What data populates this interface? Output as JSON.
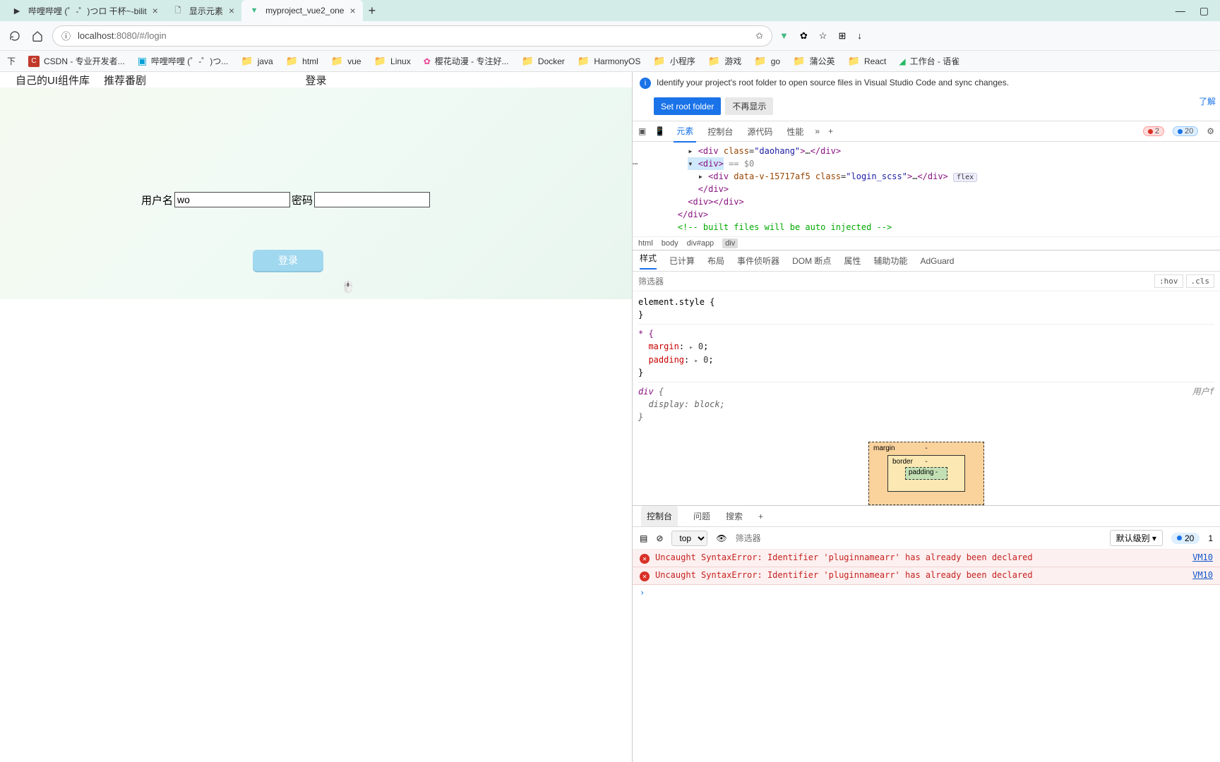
{
  "tabs": [
    {
      "title": "哔哩哔哩 (゜-゜)つロ 干杯~-bilit"
    },
    {
      "title": "显示元素"
    },
    {
      "title": "myproject_vue2_one",
      "active": true
    }
  ],
  "url": {
    "scheme": "localhost",
    "middle": ":8080/#/login"
  },
  "bookmarks": {
    "first": "下",
    "csdn": "CSDN - 专业开发者...",
    "bili": "哔哩哔哩 (゜-゜)つ...",
    "folders": [
      "java",
      "html",
      "vue",
      "Linux"
    ],
    "sakura": "樱花动漫 - 专注好...",
    "folders2": [
      "Docker",
      "HarmonyOS",
      "小程序",
      "游戏",
      "go",
      "蒲公英",
      "React"
    ],
    "workbench": "工作台 - 语雀"
  },
  "page": {
    "nav1": "自己的UI组件库",
    "nav2": "推荐番剧",
    "center_title": "登录",
    "username_label": "用户名",
    "username_value": "wo",
    "password_label": "密码",
    "login_btn": "登录"
  },
  "devtools": {
    "banner_msg": "Identify your project's root folder to open source files in Visual Studio Code and sync changes.",
    "banner_link": "了解",
    "btn_set": "Set root folder",
    "btn_hide": "不再显示",
    "tabs": [
      "元素",
      "控制台",
      "源代码",
      "性能"
    ],
    "err_count": "2",
    "info_count": "20",
    "dom": {
      "l1": "<div class=\"daohang\">…</div>",
      "l2": "<div>",
      "l2_suffix": "== $0",
      "l3": "<div data-v-15717af5 class=\"login_scss\">…</div>",
      "l3_pill": "flex",
      "l4": "</div>",
      "l5": "<div></div>",
      "l6": "</div>",
      "l7": "<!-- built files will be auto injected -->"
    },
    "breadcrumb": [
      "html",
      "body",
      "div#app",
      "div"
    ],
    "styles_tabs": [
      "样式",
      "已计算",
      "布局",
      "事件侦听器",
      "DOM 断点",
      "属性",
      "辅助功能",
      "AdGuard"
    ],
    "filter_placeholder": "筛选器",
    "hov": ":hov",
    "cls": ".cls",
    "css": {
      "element_style": "element.style {",
      "brace_close": "}",
      "star": "* {",
      "margin": "margin",
      "padding": "padding",
      "zero": "0",
      "div_sel": "div {",
      "display_block": "display: block;",
      "src_user": "用户f"
    },
    "box": {
      "margin": "margin",
      "border": "border",
      "padding": "padding",
      "dash": "-"
    }
  },
  "console": {
    "tabs": [
      "控制台",
      "问题",
      "搜索"
    ],
    "context": "top",
    "filter_placeholder": "筛选器",
    "level": "默认级别",
    "info_count": "20",
    "one": "1",
    "err1": "Uncaught SyntaxError: Identifier 'pluginnamearr' has already been declared",
    "err2": "Uncaught SyntaxError: Identifier 'pluginnamearr' has already been declared",
    "src": "VM10"
  }
}
